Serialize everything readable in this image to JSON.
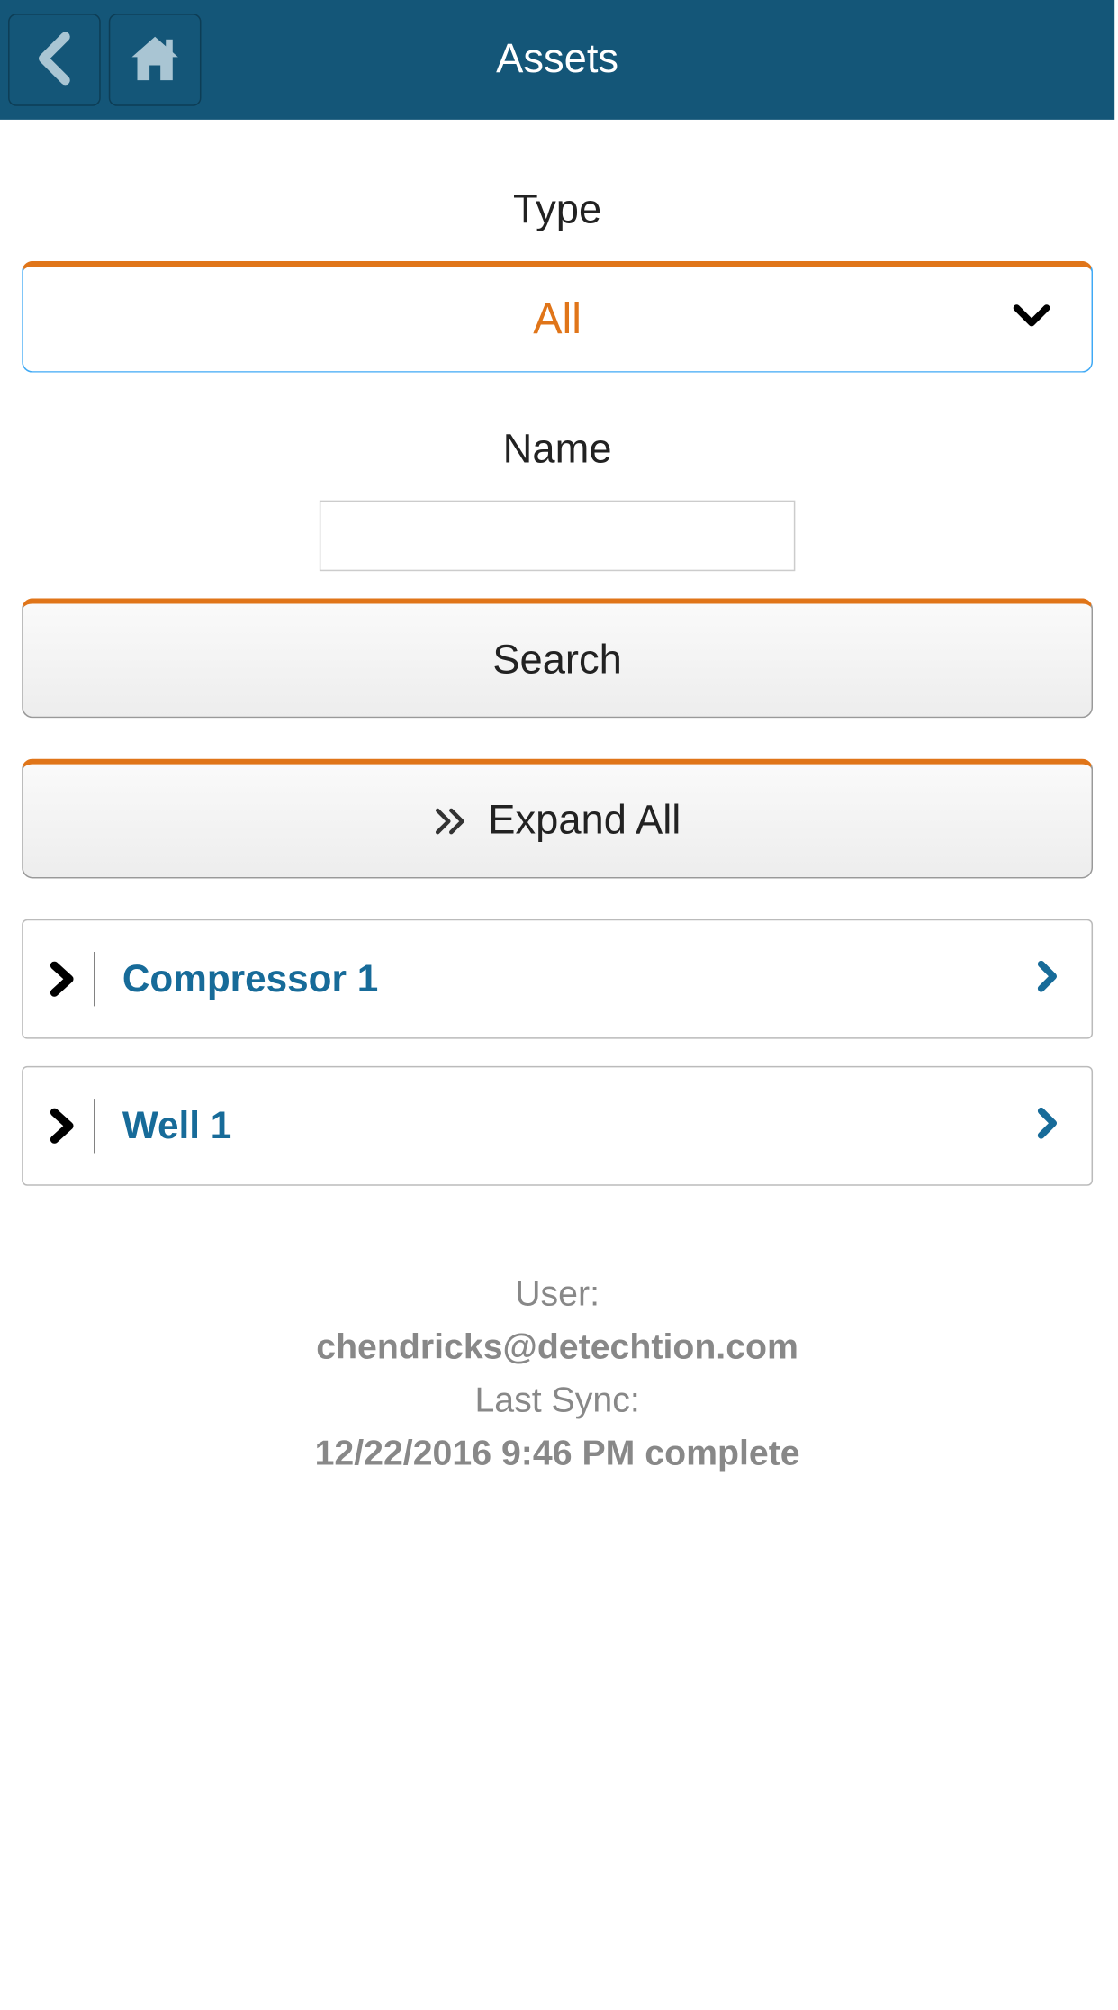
{
  "header": {
    "title": "Assets"
  },
  "filters": {
    "type_label": "Type",
    "type_value": "All",
    "name_label": "Name",
    "name_value": ""
  },
  "buttons": {
    "search": "Search",
    "expand_all": "Expand All"
  },
  "assets": [
    {
      "name": "Compressor 1"
    },
    {
      "name": "Well 1"
    }
  ],
  "footer": {
    "user_label": "User:",
    "user_value": "chendricks@detechtion.com",
    "sync_label": "Last Sync:",
    "sync_value": "12/22/2016 9:46 PM complete"
  },
  "colors": {
    "header_bg": "#145678",
    "accent": "#e07519",
    "link": "#176b99"
  }
}
